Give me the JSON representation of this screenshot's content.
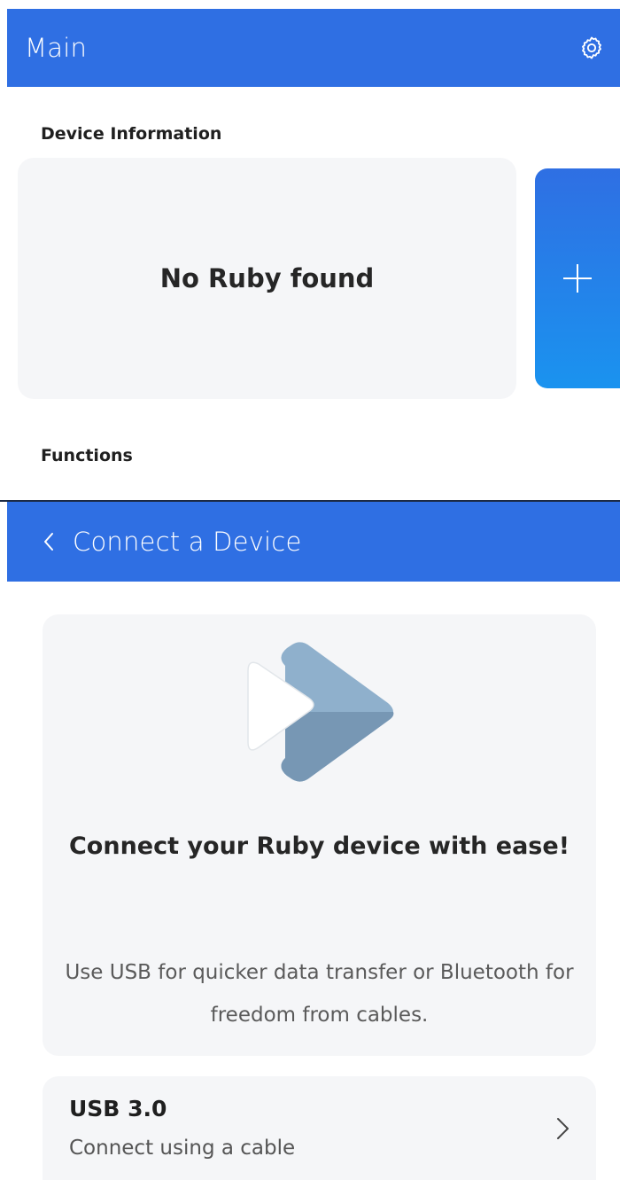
{
  "main_screen": {
    "header": {
      "title": "Main",
      "settings_icon": "gear-icon"
    },
    "device_information": {
      "label": "Device Information",
      "empty_message": "No Ruby found",
      "add_icon": "plus-icon"
    },
    "functions": {
      "label": "Functions"
    }
  },
  "connect_screen": {
    "header": {
      "title": "Connect a Device",
      "back_icon": "chevron-left-icon"
    },
    "intro": {
      "illustration_icon": "play-icon",
      "title": "Connect your Ruby device with ease!",
      "description": "Use USB for quicker data transfer or Bluetooth for freedom from cables."
    },
    "options": [
      {
        "title": "USB 3.0",
        "subtitle": "Connect using a cable",
        "icon": "chevron-right-icon"
      }
    ]
  },
  "colors": {
    "header_blue": "#2f6fe3",
    "add_button_gradient_end": "#1a93ef",
    "card_background": "#f5f6f8",
    "illustration_light": "#8fb0cc",
    "illustration_dark": "#7797b4"
  }
}
